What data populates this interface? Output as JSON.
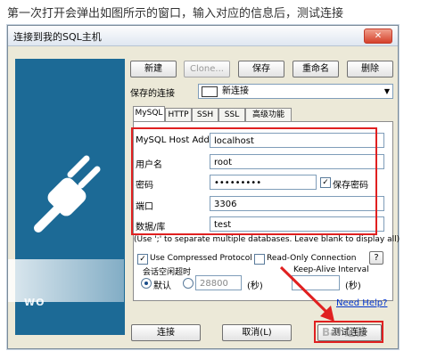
{
  "caption": "第一次打开会弹出如图所示的窗口，输入对应的信息后，测试连接",
  "window": {
    "title": "连接到我的SQL主机",
    "close_glyph": "✕"
  },
  "left_panel": {
    "brand": "WO"
  },
  "toolbar": {
    "new": "新建",
    "clone": "Clone...",
    "save": "保存",
    "rename": "重命名",
    "delete": "删除"
  },
  "saved_connection": {
    "label": "保存的连接",
    "value": "新连接"
  },
  "tabs": [
    "MySQL",
    "HTTP",
    "SSH",
    "SSL",
    "高级功能"
  ],
  "fields": {
    "host": {
      "label": "MySQL Host Address",
      "value": "localhost"
    },
    "user": {
      "label": "用户名",
      "value": "root"
    },
    "password": {
      "label": "密码",
      "value": "•••••••••"
    },
    "save_password": "保存密码",
    "port": {
      "label": "端口",
      "value": "3306"
    },
    "database": {
      "label": "数据/库",
      "value": "test"
    }
  },
  "hint": "(Use ';' to separate multiple databases. Leave blank to display all)",
  "options": {
    "compressed": "Use Compressed Protocol",
    "readonly": "Read-Only Connection",
    "help_q": "?"
  },
  "timeout": {
    "label": "会话空闲超时",
    "default": "默认",
    "value": "28800",
    "unit": "(秒)"
  },
  "keepalive": {
    "label": "Keep-Alive Interval",
    "unit": "(秒)"
  },
  "need_help": "Need Help?",
  "bottom": {
    "connect": "连接",
    "cancel": "取消(L)",
    "test": "测试连接"
  },
  "watermark": "Bai 经验",
  "colors": {
    "highlight": "#e02020",
    "panel": "#1c6a96",
    "dialog_bg": "#ece9d8"
  }
}
